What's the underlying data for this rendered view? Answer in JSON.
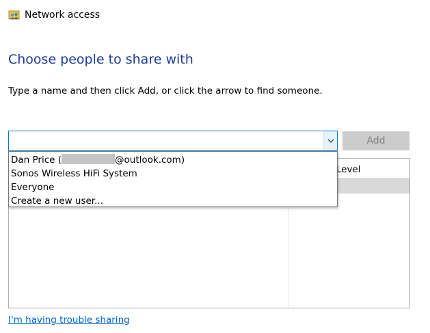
{
  "window": {
    "title": "Network access",
    "icon": "network-people-icon"
  },
  "heading": "Choose people to share with",
  "instruction": "Type a name and then click Add, or click the arrow to find someone.",
  "name_input": {
    "value": "",
    "placeholder": ""
  },
  "add_button": {
    "label": "Add",
    "enabled": false
  },
  "grid": {
    "permission_header_partial": "n Level"
  },
  "dropdown": {
    "items": [
      {
        "prefix": "Dan Price (",
        "suffix": "@outlook.com)",
        "redacted": true
      },
      {
        "label": "Sonos Wireless HiFi System"
      },
      {
        "label": "Everyone"
      },
      {
        "label": "Create a new user..."
      }
    ]
  },
  "trouble_link": "I'm having trouble sharing",
  "colors": {
    "heading": "#1a3a9a",
    "link": "#0066cc",
    "focus_border": "#0078d7",
    "disabled_button": "#cccccc"
  }
}
